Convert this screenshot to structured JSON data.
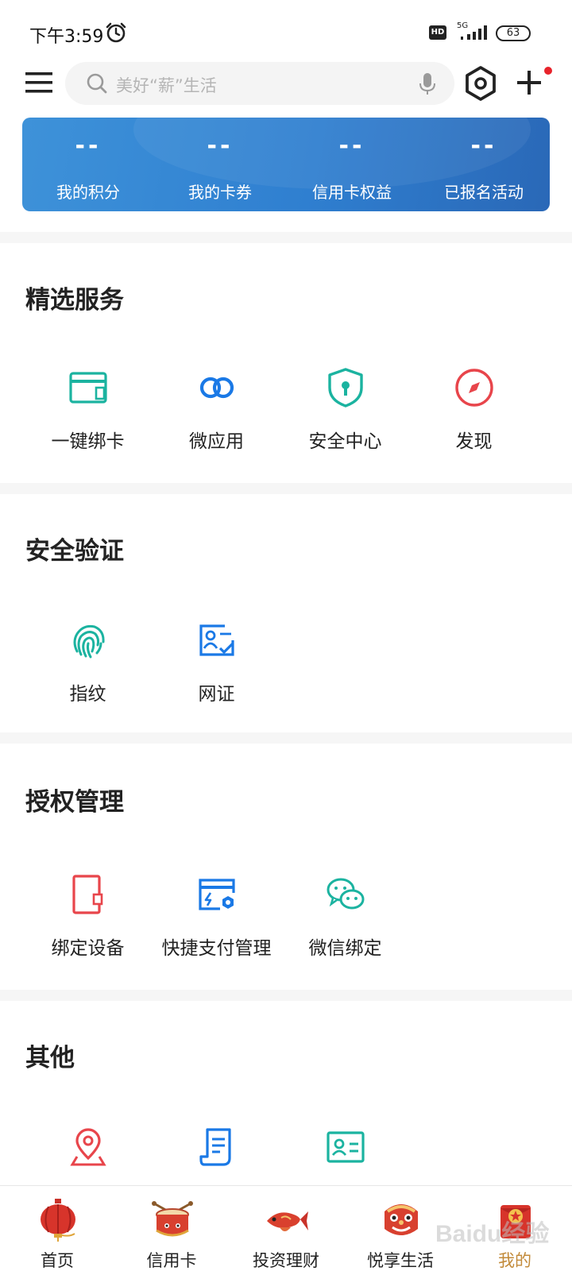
{
  "status_bar": {
    "time": "下午3:59",
    "hd": "HD",
    "network": "5G",
    "battery": "63"
  },
  "header": {
    "search_placeholder": "美好“薪”生活"
  },
  "stats": [
    {
      "value": "--",
      "label": "我的积分"
    },
    {
      "value": "--",
      "label": "我的卡券"
    },
    {
      "value": "--",
      "label": "信用卡权益"
    },
    {
      "value": "--",
      "label": "已报名活动"
    }
  ],
  "sections": [
    {
      "title": "精选服务",
      "items": [
        {
          "label": "一键绑卡",
          "icon": "card-bind-icon",
          "color": "#1bb3a0"
        },
        {
          "label": "微应用",
          "icon": "link-icon",
          "color": "#1a79e6"
        },
        {
          "label": "安全中心",
          "icon": "shield-lock-icon",
          "color": "#1bb3a0"
        },
        {
          "label": "发现",
          "icon": "compass-icon",
          "color": "#e8454b"
        }
      ]
    },
    {
      "title": "安全验证",
      "items": [
        {
          "label": "指纹",
          "icon": "fingerprint-icon",
          "color": "#1bb3a0"
        },
        {
          "label": "网证",
          "icon": "id-verify-icon",
          "color": "#1a79e6"
        }
      ]
    },
    {
      "title": "授权管理",
      "items": [
        {
          "label": "绑定设备",
          "icon": "device-icon",
          "color": "#e8454b"
        },
        {
          "label": "快捷支付管理",
          "icon": "quick-pay-icon",
          "color": "#1a79e6"
        },
        {
          "label": "微信绑定",
          "icon": "wechat-icon",
          "color": "#1bb3a0"
        }
      ]
    },
    {
      "title": "其他",
      "items": [
        {
          "label": "",
          "icon": "location-icon",
          "color": "#e8454b"
        },
        {
          "label": "",
          "icon": "document-icon",
          "color": "#1a79e6"
        },
        {
          "label": "",
          "icon": "id-card-icon",
          "color": "#1bb3a0"
        }
      ]
    }
  ],
  "bottom_nav": [
    {
      "label": "首页",
      "icon": "lantern-icon"
    },
    {
      "label": "信用卡",
      "icon": "drum-icon"
    },
    {
      "label": "投资理财",
      "icon": "fish-icon"
    },
    {
      "label": "悦享生活",
      "icon": "lion-dance-icon"
    },
    {
      "label": "我的",
      "icon": "red-envelope-icon",
      "active": true
    }
  ],
  "watermark": "Baidu经验",
  "colors": {
    "banner": "#2f7fd0",
    "active_nav": "#c28a3a",
    "green": "#1bb3a0",
    "blue": "#1a79e6",
    "red": "#e8454b"
  }
}
